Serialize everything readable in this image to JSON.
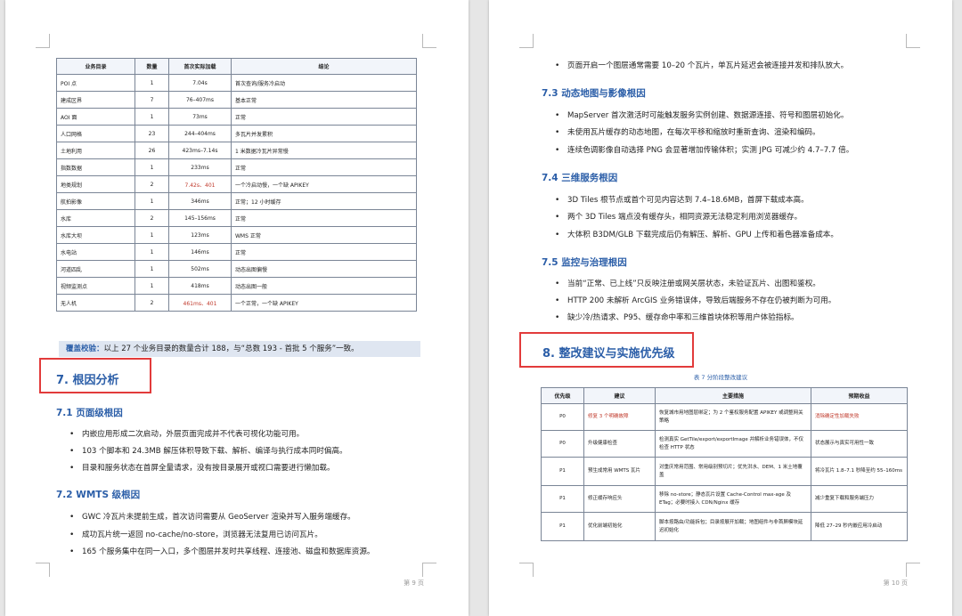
{
  "left_page": {
    "table": {
      "headers": [
        "业务目录",
        "数量",
        "首次实际加载",
        "结论"
      ],
      "rows": [
        {
          "name": "POI 点",
          "count": "1",
          "load": "7.04s",
          "conclusion": "首次查询/服务冷启动"
        },
        {
          "name": "建成区界",
          "count": "7",
          "load": "76–407ms",
          "conclusion": "基本正常"
        },
        {
          "name": "AOI 面",
          "count": "1",
          "load": "73ms",
          "conclusion": "正常"
        },
        {
          "name": "人口网格",
          "count": "23",
          "load": "244–404ms",
          "conclusion": "多瓦片并发累积"
        },
        {
          "name": "土地利用",
          "count": "26",
          "load": "423ms–7.14s",
          "conclusion": "1 米数据冷瓦片异常慢"
        },
        {
          "name": "指数数据",
          "count": "1",
          "load": "233ms",
          "conclusion": "正常"
        },
        {
          "name": "地类规划",
          "count": "2",
          "load": "7.42s、401",
          "conclusion": "一个冷启动慢，一个缺 APIKEY"
        },
        {
          "name": "航拍影像",
          "count": "1",
          "load": "346ms",
          "conclusion": "正常；12 小时缓存"
        },
        {
          "name": "水库",
          "count": "2",
          "load": "145–156ms",
          "conclusion": "正常"
        },
        {
          "name": "水库大坝",
          "count": "1",
          "load": "123ms",
          "conclusion": "WMS 正常"
        },
        {
          "name": "水电站",
          "count": "1",
          "load": "146ms",
          "conclusion": "正常"
        },
        {
          "name": "河道四乱",
          "count": "1",
          "load": "502ms",
          "conclusion": "动态出图偏慢"
        },
        {
          "name": "视频监测点",
          "count": "1",
          "load": "418ms",
          "conclusion": "动态出图一般"
        },
        {
          "name": "无人机",
          "count": "2",
          "load": "461ms、401",
          "conclusion": "一个正常，一个缺 APIKEY"
        }
      ]
    },
    "coverage": {
      "label": "覆盖校验：",
      "text": "以上 27 个业务目录的数量合计 188，与“总数 193 - 首批 5 个服务”一致。"
    },
    "section7_title": "7. 根因分析",
    "s71": {
      "title": "7.1 页面级根因",
      "bullets": [
        "内嵌应用形成二次启动，外层页面完成并不代表可视化功能可用。",
        "103 个脚本和 24.3MB 解压体积导致下载、解析、编译与执行成本同时偏高。",
        "目录和服务状态在首屏全量请求，没有按目录展开或视口需要进行懒加载。"
      ]
    },
    "s72": {
      "title": "7.2 WMTS 级根因",
      "bullets": [
        "GWC 冷瓦片未提前生成，首次访问需要从 GeoServer 渲染并写入服务端缓存。",
        "成功瓦片统一返回 no-cache/no-store，浏览器无法复用已访问瓦片。",
        "165 个服务集中在同一入口，多个图层并发时共享线程、连接池、磁盘和数据库资源。"
      ]
    },
    "page_number": "第 9 页"
  },
  "right_page": {
    "top_bullet": "页面开启一个图层通常需要 10–20 个瓦片，单瓦片延迟会被连接并发和排队放大。",
    "s73": {
      "title": "7.3 动态地图与影像根因",
      "bullets": [
        "MapServer 首次激活时可能触发服务实例创建、数据源连接、符号和图层初始化。",
        "未使用瓦片缓存的动态地图，在每次平移和缩放时重新查询、渲染和编码。",
        "连续色调影像自动选择 PNG 会显著增加传输体积；实测 JPG 可减少约 4.7–7.7 倍。"
      ]
    },
    "s74": {
      "title": "7.4 三维服务根因",
      "bullets": [
        "3D Tiles 根节点或首个可见内容达到 7.4–18.6MB，首屏下载成本高。",
        "两个 3D Tiles 端点没有缓存头，相同资源无法稳定利用浏览器缓存。",
        "大体积 B3DM/GLB 下载完成后仍有解压、解析、GPU 上传和着色器准备成本。"
      ]
    },
    "s75": {
      "title": "7.5 监控与治理根因",
      "bullets": [
        "当前“正常、已上线”只反映注册或网关层状态，未验证瓦片、出图和鉴权。",
        "HTTP 200 未解析 ArcGIS 业务错误体，导致后端服务不存在仍被判断为可用。",
        "缺少冷/热请求、P95、缓存命中率和三维首块体积等用户体验指标。"
      ]
    },
    "section8_title": "8. 整改建议与实施优先级",
    "table_caption": "表 7  分阶段整改建议",
    "table": {
      "headers": [
        "优先级",
        "建议",
        "主要措施",
        "预期收益"
      ],
      "rows": [
        {
          "priority": "P0",
          "advice": "修复 3 个明确故障",
          "measures": "恢复城市用地图层绑定；为 2 个鉴权服务配置 APIKEY 或调整网关策略",
          "benefit": "消除确定性加载失败"
        },
        {
          "priority": "P0",
          "advice": "升级健康检查",
          "measures": "检测真实 GetTile/export/exportImage 并解析业务错误体，不仅检查 HTTP 状态",
          "benefit": "状态展示与真实可用性一致"
        },
        {
          "priority": "P1",
          "advice": "预生成常用 WMTS 瓦片",
          "measures": "对重庆常用范围、常用级别预切片；优先洪水、DEM、1 米土地覆盖",
          "benefit": "将冷瓦片 1.8–7.1 秒降至约 55–160ms"
        },
        {
          "priority": "P1",
          "advice": "修正缓存响应头",
          "measures": "移除 no-store；静态瓦片设置 Cache-Control max-age 及 ETag；必要时接入 CDN/Nginx 缓存",
          "benefit": "减少重复下载和服务端压力"
        },
        {
          "priority": "P1",
          "advice": "优化前端初始化",
          "measures": "脚本按路由/功能拆包；目录按展开加载；地图组件与非首屏模块延迟初始化",
          "benefit": "降低 27–29 秒内嵌应用冷启动"
        }
      ]
    },
    "page_number": "第 10 页"
  }
}
